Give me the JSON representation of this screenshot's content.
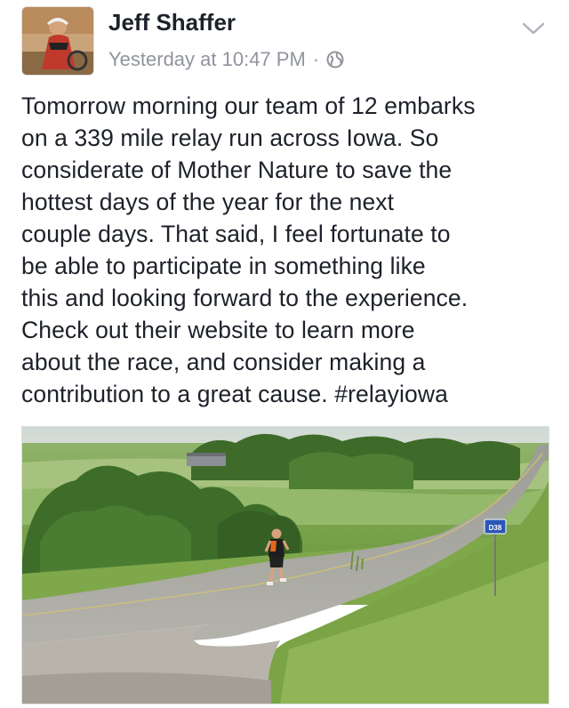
{
  "post": {
    "author_name": "Jeff Shaffer",
    "timestamp": "Yesterday at 10:47 PM",
    "separator": "·",
    "audience_icon": "globe-icon",
    "menu_icon": "chevron-down-icon",
    "text": "Tomorrow morning our team of 12 embarks\non a 339 mile relay run across Iowa. So\nconsiderate of Mother Nature to save the\nhottest days of the year for the next\ncouple days. That said, I feel fortunate to\nbe able to participate in something like\nthis and looking forward to the experience.\nCheck out their website to learn more\nabout the race, and consider making a\ncontribution to a great cause. #relayiowa",
    "photo": {
      "road_sign_text": "D38"
    }
  },
  "colors": {
    "name": "#1d2129",
    "meta": "#90949c",
    "grass": "#6e9a3a",
    "road": "#a9a9a4",
    "trees": "#3f6e2a",
    "sky": "#d9e1da",
    "sign": "#2b55b8"
  }
}
